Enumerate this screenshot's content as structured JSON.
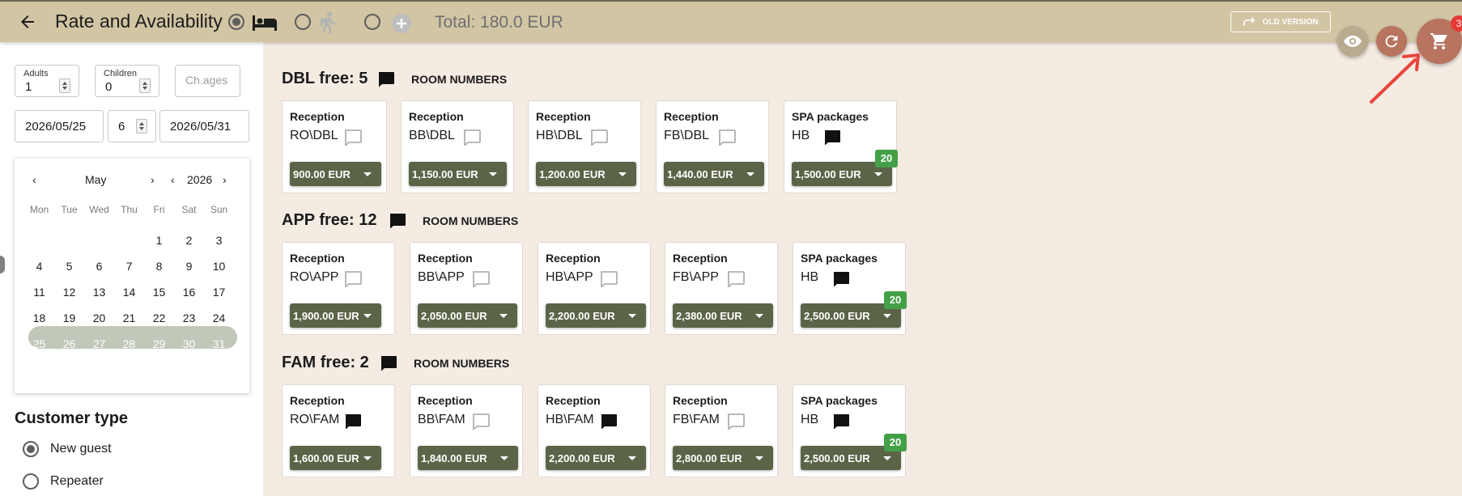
{
  "header": {
    "title": "Rate and Availability",
    "total": "Total: 180.0 EUR",
    "old_version": "OLD VERSION",
    "cart_count": "3",
    "mode_options": [
      {
        "icon": "bed-icon",
        "selected": true
      },
      {
        "icon": "walking-person-icon",
        "selected": false
      },
      {
        "icon": "add-circle-icon",
        "selected": false
      }
    ]
  },
  "sidebar": {
    "adults": {
      "label": "Adults",
      "value": "1"
    },
    "children": {
      "label": "Children",
      "value": "0"
    },
    "child_ages": {
      "placeholder": "Ch.ages"
    },
    "date_from": "2026/05/25",
    "nights": "6",
    "date_to": "2026/05/31",
    "calendar": {
      "month": "May",
      "year": "2026",
      "weekdays": [
        "Mon",
        "Tue",
        "Wed",
        "Thu",
        "Fri",
        "Sat",
        "Sun"
      ],
      "weeks": [
        [
          "",
          "",
          "",
          "",
          "1",
          "2",
          "3"
        ],
        [
          "4",
          "5",
          "6",
          "7",
          "8",
          "9",
          "10"
        ],
        [
          "11",
          "12",
          "13",
          "14",
          "15",
          "16",
          "17"
        ],
        [
          "18",
          "19",
          "20",
          "21",
          "22",
          "23",
          "24"
        ],
        [
          "25",
          "26",
          "27",
          "28",
          "29",
          "30",
          "31"
        ]
      ],
      "range_start": "25",
      "range_end": "31"
    },
    "customer_type": {
      "title": "Customer type",
      "options": [
        {
          "label": "New guest",
          "selected": true
        },
        {
          "label": "Repeater",
          "selected": false
        }
      ]
    }
  },
  "room_numbers_label": "ROOM NUMBERS",
  "sections": [
    {
      "title": "DBL free: 5",
      "cards": [
        {
          "title": "Reception",
          "code": "RO\\DBL",
          "comment_filled": false,
          "price": "900.00 EUR",
          "badge": ""
        },
        {
          "title": "Reception",
          "code": "BB\\DBL",
          "comment_filled": false,
          "price": "1,150.00 EUR",
          "badge": ""
        },
        {
          "title": "Reception",
          "code": "HB\\DBL",
          "comment_filled": false,
          "price": "1,200.00 EUR",
          "badge": ""
        },
        {
          "title": "Reception",
          "code": "FB\\DBL",
          "comment_filled": false,
          "price": "1,440.00 EUR",
          "badge": ""
        },
        {
          "title": "SPA packages",
          "code": "HB",
          "comment_filled": true,
          "price": "1,500.00 EUR",
          "badge": "20"
        }
      ]
    },
    {
      "title": "APP free: 12",
      "cards": [
        {
          "title": "Reception",
          "code": "RO\\APP",
          "comment_filled": false,
          "price": "1,900.00 EUR",
          "badge": ""
        },
        {
          "title": "Reception",
          "code": "BB\\APP",
          "comment_filled": false,
          "price": "2,050.00 EUR",
          "badge": ""
        },
        {
          "title": "Reception",
          "code": "HB\\APP",
          "comment_filled": false,
          "price": "2,200.00 EUR",
          "badge": ""
        },
        {
          "title": "Reception",
          "code": "FB\\APP",
          "comment_filled": false,
          "price": "2,380.00 EUR",
          "badge": ""
        },
        {
          "title": "SPA packages",
          "code": "HB",
          "comment_filled": true,
          "price": "2,500.00 EUR",
          "badge": "20"
        }
      ]
    },
    {
      "title": "FAM free: 2",
      "cards": [
        {
          "title": "Reception",
          "code": "RO\\FAM",
          "comment_filled": true,
          "price": "1,600.00 EUR",
          "badge": ""
        },
        {
          "title": "Reception",
          "code": "BB\\FAM",
          "comment_filled": false,
          "price": "1,840.00 EUR",
          "badge": ""
        },
        {
          "title": "Reception",
          "code": "HB\\FAM",
          "comment_filled": true,
          "price": "2,200.00 EUR",
          "badge": ""
        },
        {
          "title": "Reception",
          "code": "FB\\FAM",
          "comment_filled": false,
          "price": "2,800.00 EUR",
          "badge": ""
        },
        {
          "title": "SPA packages",
          "code": "HB",
          "comment_filled": true,
          "price": "2,500.00 EUR",
          "badge": "20"
        }
      ]
    }
  ],
  "colors": {
    "header_bg": "#d2c5a4",
    "page_bg": "#f4ebe3",
    "price_button": "#5c6448",
    "badge_green": "#43a047",
    "cart_fab": "#b8745e",
    "cart_badge": "#e53935",
    "range_selected": "#5b6a4c",
    "annotation_arrow": "#e8453c"
  }
}
